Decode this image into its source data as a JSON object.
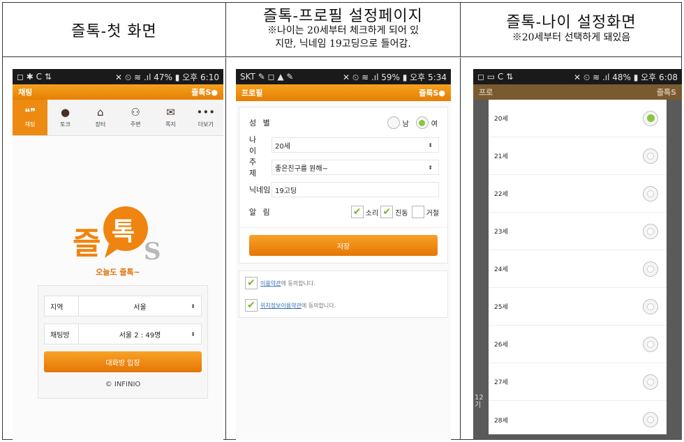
{
  "headers": [
    {
      "title": "즐톡-첫 화면",
      "notes": []
    },
    {
      "title": "즐톡-프로필 설정페이지",
      "notes": [
        "※나이는 20세부터 체크하게 되어 있",
        "지만, 닉네임 19고딩으로 들어감."
      ]
    },
    {
      "title": "즐톡-나이 설정화면",
      "notes": [
        "※20세부터 선택하게 돼있음"
      ]
    }
  ],
  "screen1": {
    "status_left": "◻ ✱ C ⇅",
    "status_right": "✕ ⏲ ≋ .ıl 47% ▮ 오후 6:10",
    "appbar_title": "채팅",
    "brand": "즐톡S●",
    "tabs": [
      "채팅",
      "토크",
      "장터",
      "주변",
      "쪽지",
      "더보기"
    ],
    "logo_text": "즐톡",
    "logo_s": "S",
    "slogan": "오늘도 즐톡~",
    "region_label": "지역",
    "region_value": "서울",
    "room_label": "채팅방",
    "room_value": "서울 2 : 49명",
    "enter_button": "대화방 입장",
    "copyright": "© INFINIO"
  },
  "screen2": {
    "status_left": "SKT ✎ ◻ ▲ ✎",
    "status_right": "✕ ⏲ ≋ .ıl 59% ▮ 오후 5:34",
    "appbar_title": "프로필",
    "brand": "즐톡S●",
    "gender_label": "성 별",
    "gender_male": "남",
    "gender_female": "여",
    "age_label": "나 이",
    "age_value": "20세",
    "topic_label": "주 제",
    "topic_value": "좋은친구를 원해~",
    "nick_label": "닉네임",
    "nick_value": "19고딩",
    "alarm_label": "알 림",
    "alarm_sound": "소리",
    "alarm_vibe": "진동",
    "alarm_reject": "거절",
    "save_button": "저장",
    "agree1_link": "이용약관",
    "agree1_text": "에 동의합니다.",
    "agree2_link": "위치정보이용약관",
    "agree2_text": "에 동의합니다."
  },
  "screen3": {
    "status_left": "◻ ▭ C ⇅",
    "status_right": "✕ ⏲ ≋ .ıl 48% ▮ 오후 6:08",
    "appbar_title": "프로",
    "brand": "즐톡S",
    "ages": [
      "20세",
      "21세",
      "22세",
      "23세",
      "24세",
      "25세",
      "26세",
      "27세",
      "28세"
    ],
    "selected_index": 0,
    "behind_text": "12 기"
  },
  "colors": {
    "orange": "#ec8a11",
    "green": "#8bc63f",
    "brown": "#4a2f24"
  }
}
